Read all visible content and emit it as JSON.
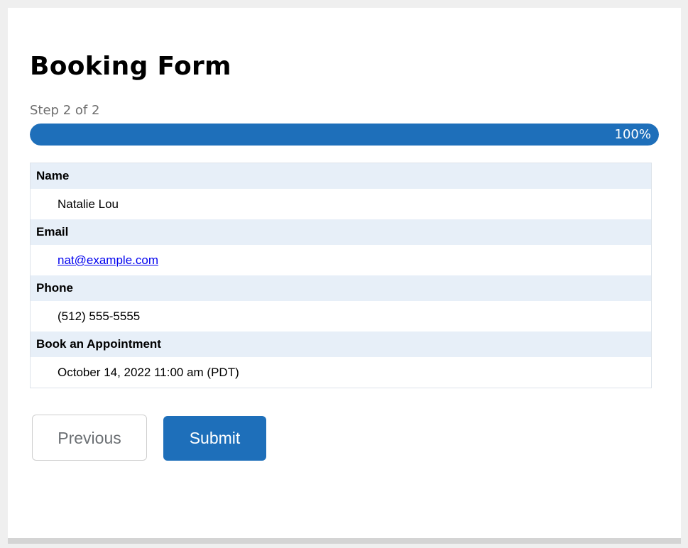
{
  "form": {
    "title": "Booking Form",
    "step_text": "Step 2 of 2",
    "progress": {
      "percent": 100,
      "label": "100%"
    }
  },
  "review": {
    "fields": [
      {
        "label": "Name",
        "value": "Natalie Lou"
      },
      {
        "label": "Email",
        "value": "nat@example.com"
      },
      {
        "label": "Phone",
        "value": "(512) 555-5555"
      },
      {
        "label": "Book an Appointment",
        "value": "October 14, 2022 11:00 am (PDT)"
      }
    ]
  },
  "buttons": {
    "previous_label": "Previous",
    "submit_label": "Submit"
  },
  "colors": {
    "accent": "#1e6fba",
    "label_row_bg": "#e7eff8",
    "link": "#0000ee"
  }
}
